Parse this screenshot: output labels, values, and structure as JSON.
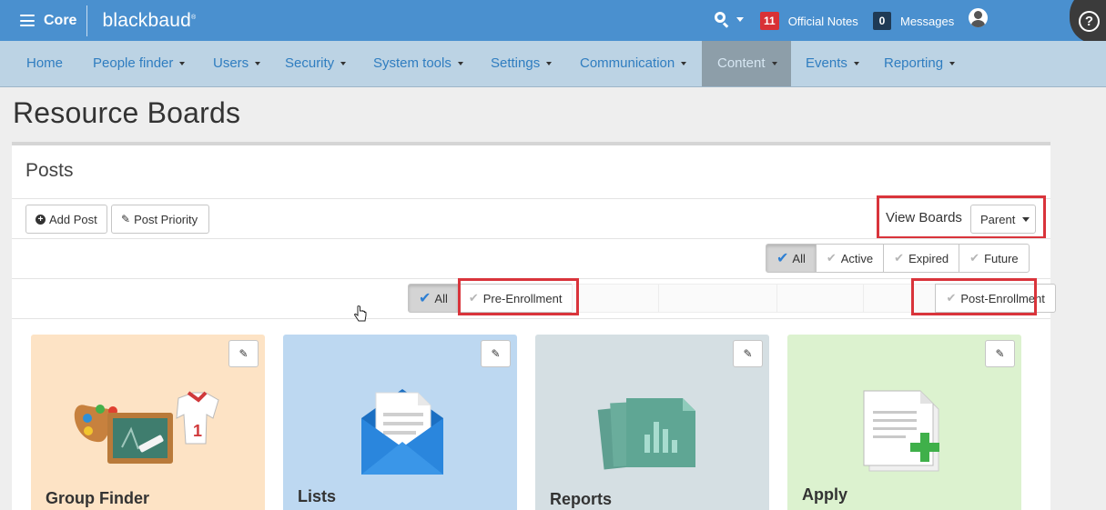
{
  "topbar": {
    "core_label": "Core",
    "logo_text": "blackbaud",
    "official_notes_count": "11",
    "official_notes_label": "Official Notes",
    "messages_count": "0",
    "messages_label": "Messages",
    "help_glyph": "?"
  },
  "nav": {
    "items": [
      {
        "label": "Home"
      },
      {
        "label": "People finder"
      },
      {
        "label": "Users"
      },
      {
        "label": "Security"
      },
      {
        "label": "System tools"
      },
      {
        "label": "Settings"
      },
      {
        "label": "Communication"
      },
      {
        "label": "Content"
      },
      {
        "label": "Events"
      },
      {
        "label": "Reporting"
      }
    ],
    "active": "Content"
  },
  "page": {
    "title": "Resource Boards",
    "section_title": "Posts"
  },
  "toolbar": {
    "add_post_label": "Add Post",
    "post_priority_label": "Post Priority",
    "view_boards_label": "View Boards",
    "view_boards_value": "Parent"
  },
  "status_filter": {
    "options": [
      "All",
      "Active",
      "Expired",
      "Future"
    ],
    "selected": "All"
  },
  "category_filter": {
    "options": [
      "All",
      "Pre-Enrollment",
      "Post-Enrollment"
    ],
    "selected": "All"
  },
  "cards": [
    {
      "title": "Group Finder",
      "color": "#fde3c5"
    },
    {
      "title": "Lists",
      "color": "#bdd8f1"
    },
    {
      "title": "Reports",
      "color": "#d5dfe3"
    },
    {
      "title": "Apply",
      "color": "#dcf2cf"
    }
  ],
  "colors": {
    "topbar": "#4a90cf",
    "navbar": "#bcd3e4",
    "nav_link": "#2f7dc0",
    "highlight": "#d9343b"
  },
  "icons": {
    "menu": "hamburger-icon",
    "search": "search-icon",
    "user": "user-icon",
    "help": "help-icon",
    "add": "plus-circle-icon",
    "edit": "pencil-icon",
    "check": "checkmark-icon"
  }
}
